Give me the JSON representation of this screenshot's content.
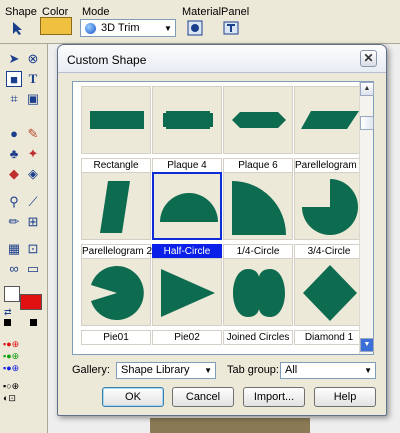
{
  "toolbar": {
    "shape_label": "Shape",
    "color_label": "Color",
    "mode_label": "Mode",
    "mode_value": "3D Trim",
    "material_label": "Material",
    "panel_label": "Panel",
    "color_value": "#f0c040"
  },
  "dialog": {
    "title": "Custom Shape",
    "close_glyph": "✕"
  },
  "shapes": [
    {
      "label": "Rectangle"
    },
    {
      "label": "Plaque 4"
    },
    {
      "label": "Plaque 6"
    },
    {
      "label": "Parellelogram 1"
    },
    {
      "label": "Parellelogram 2"
    },
    {
      "label": "Half-Circle",
      "selected": true
    },
    {
      "label": "1/4-Circle"
    },
    {
      "label": "3/4-Circle"
    },
    {
      "label": "Pie01"
    },
    {
      "label": "Pie02"
    },
    {
      "label": "Joined Circles"
    },
    {
      "label": "Diamond 1"
    }
  ],
  "controls": {
    "gallery_label": "Gallery:",
    "gallery_value": "Shape Library",
    "tabgroup_label": "Tab group:",
    "tabgroup_value": "All"
  },
  "buttons": {
    "ok": "OK",
    "cancel": "Cancel",
    "import": "Import...",
    "help": "Help"
  },
  "colors": {
    "shape_fill": "#0d6b4f",
    "selection": "#0a20e8",
    "accent_red": "#e01010"
  }
}
